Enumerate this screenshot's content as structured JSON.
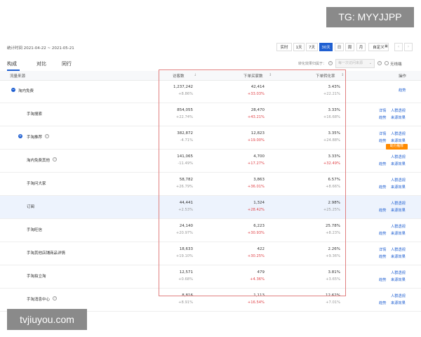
{
  "watermarks": {
    "top": "TG: MYYJJPP",
    "bottom": "tvjiuyou.com"
  },
  "stat_time": "统计时间 2021-04-22 ~ 2021-05-21",
  "time_buttons": [
    "实时",
    "1天",
    "7天",
    "30天",
    "日",
    "周",
    "月",
    "自定义"
  ],
  "active_time_button": "30天",
  "tabs": [
    "构成",
    "对比",
    "同行"
  ],
  "active_tab": "构成",
  "filter": {
    "label": "转化效果归属于：",
    "placeholder": "每一次访问来源",
    "radio_label": "无线端"
  },
  "table": {
    "headers": {
      "source": "流量来源",
      "visitors": "访客数",
      "buyers": "下单买家数",
      "conversion": "下单转化率",
      "action": "操作"
    },
    "rows": [
      {
        "name": "淘内免费",
        "expand": "−",
        "help": false,
        "visitors": "1,237,242",
        "visitors_change": "+8.86%",
        "visitors_dir": "up",
        "buyers": "42,414",
        "buyers_change": "+33.03%",
        "buyers_dir": "up",
        "conversion": "3.43%",
        "conversion_change": "+22.21%",
        "conversion_dir": "up",
        "links": [
          "趋势"
        ]
      },
      {
        "name": "手淘搜索",
        "expand": "",
        "help": false,
        "visitors": "854,055",
        "visitors_change": "+22.74%",
        "visitors_dir": "up",
        "buyers": "28,470",
        "buyers_change": "+43.21%",
        "buyers_dir": "up",
        "conversion": "3.33%",
        "conversion_change": "+16.68%",
        "conversion_dir": "up",
        "links": [
          "详情",
          "人群透视",
          "趋势",
          "来源效果"
        ]
      },
      {
        "name": "手淘推荐",
        "expand": "+",
        "help": true,
        "visitors": "382,872",
        "visitors_change": "-4.71%",
        "visitors_dir": "down",
        "buyers": "12,823",
        "buyers_change": "+19.00%",
        "buyers_dir": "up",
        "conversion": "3.35%",
        "conversion_change": "+24.88%",
        "conversion_dir": "up",
        "links": [
          "详情",
          "人群透视",
          "趋势",
          "来源效果"
        ],
        "badge": "助力推荐"
      },
      {
        "name": "淘内免费其他",
        "expand": "",
        "help": true,
        "visitors": "141,065",
        "visitors_change": "-11.49%",
        "visitors_dir": "down",
        "buyers": "4,700",
        "buyers_change": "+17.27%",
        "buyers_dir": "up",
        "conversion": "3.33%",
        "conversion_change": "+32.49%",
        "conversion_dir": "up",
        "links": [
          "人群透视",
          "趋势",
          "来源效果"
        ]
      },
      {
        "name": "手淘问大家",
        "expand": "",
        "help": false,
        "visitors": "58,782",
        "visitors_change": "+26.79%",
        "visitors_dir": "up",
        "buyers": "3,863",
        "buyers_change": "+36.01%",
        "buyers_dir": "up",
        "conversion": "6.57%",
        "conversion_change": "+8.66%",
        "conversion_dir": "up",
        "links": [
          "人群透视",
          "趋势",
          "来源效果"
        ]
      },
      {
        "name": "订阅",
        "expand": "",
        "help": false,
        "visitors": "44,441",
        "visitors_change": "+2.53%",
        "visitors_dir": "up",
        "buyers": "1,324",
        "buyers_change": "+28.42%",
        "buyers_dir": "up",
        "conversion": "2.98%",
        "conversion_change": "+25.25%",
        "conversion_dir": "up",
        "links": [
          "人群透视",
          "趋势",
          "来源效果"
        ],
        "highlight": true
      },
      {
        "name": "手淘旺信",
        "expand": "",
        "help": false,
        "visitors": "24,140",
        "visitors_change": "+20.97%",
        "visitors_dir": "up",
        "buyers": "6,223",
        "buyers_change": "+30.93%",
        "buyers_dir": "up",
        "conversion": "25.78%",
        "conversion_change": "+8.23%",
        "conversion_dir": "up",
        "links": [
          "人群透视",
          "趋势",
          "来源效果"
        ]
      },
      {
        "name": "手淘其他店铺商品详情",
        "expand": "",
        "help": false,
        "visitors": "18,633",
        "visitors_change": "+19.10%",
        "visitors_dir": "up",
        "buyers": "422",
        "buyers_change": "+30.25%",
        "buyers_dir": "up",
        "conversion": "2.26%",
        "conversion_change": "+9.36%",
        "conversion_dir": "up",
        "links": [
          "详情",
          "人群透视",
          "趋势",
          "来源效果"
        ]
      },
      {
        "name": "手淘拍立淘",
        "expand": "",
        "help": false,
        "visitors": "12,571",
        "visitors_change": "+0.68%",
        "visitors_dir": "up",
        "buyers": "479",
        "buyers_change": "+4.36%",
        "buyers_dir": "up",
        "conversion": "3.81%",
        "conversion_change": "+3.65%",
        "conversion_dir": "up",
        "links": [
          "人群透视",
          "趋势",
          "来源效果"
        ]
      },
      {
        "name": "手淘消息中心",
        "expand": "",
        "help": true,
        "visitors": "8,816",
        "visitors_change": "+8.91%",
        "visitors_dir": "up",
        "buyers": "1,113",
        "buyers_change": "+16.54%",
        "buyers_dir": "up",
        "conversion": "12.62%",
        "conversion_change": "+7.01%",
        "conversion_dir": "up",
        "links": [
          "人群透视",
          "趋势",
          "来源效果"
        ]
      }
    ]
  },
  "colors": {
    "accent": "#1f5fd1",
    "increase": "#e0454a",
    "highlight_row": "#edf3fd",
    "box": "#e07f7f",
    "badge": "#ff8a00"
  }
}
